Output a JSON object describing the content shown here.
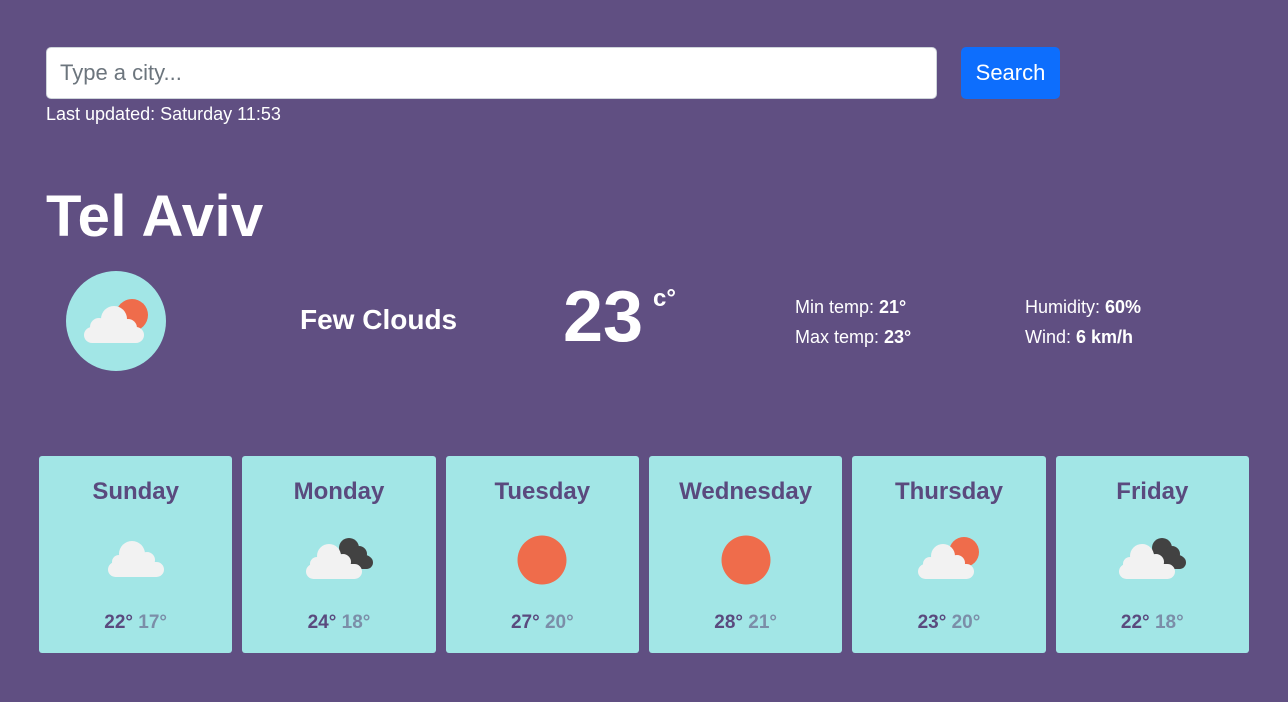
{
  "search": {
    "placeholder": "Type a city...",
    "button_label": "Search"
  },
  "last_updated": {
    "label": "Last updated: ",
    "value": "Saturday 11:53"
  },
  "city": "Tel Aviv",
  "current": {
    "icon": "few-clouds-icon",
    "description": "Few Clouds",
    "temperature": "23",
    "unit": "c°",
    "min_label": "Min temp: ",
    "min_value": "21°",
    "max_label": "Max temp: ",
    "max_value": "23°",
    "humidity_label": "Humidity: ",
    "humidity_value": "60%",
    "wind_label": "Wind: ",
    "wind_value": "6 km/h"
  },
  "forecast": [
    {
      "day": "Sunday",
      "icon": "cloud-icon",
      "max": "22°",
      "min": "17°"
    },
    {
      "day": "Monday",
      "icon": "broken-clouds-icon",
      "max": "24°",
      "min": "18°"
    },
    {
      "day": "Tuesday",
      "icon": "sun-icon",
      "max": "27°",
      "min": "20°"
    },
    {
      "day": "Wednesday",
      "icon": "sun-icon",
      "max": "28°",
      "min": "21°"
    },
    {
      "day": "Thursday",
      "icon": "few-clouds-icon",
      "max": "23°",
      "min": "20°"
    },
    {
      "day": "Friday",
      "icon": "broken-clouds-icon",
      "max": "22°",
      "min": "18°"
    }
  ],
  "colors": {
    "background": "#604f82",
    "card": "#a2e6e6",
    "accent_button": "#0d6efd",
    "sun": "#ef6c4b",
    "dark_cloud": "#424242",
    "light_cloud": "#f2f2f2"
  }
}
